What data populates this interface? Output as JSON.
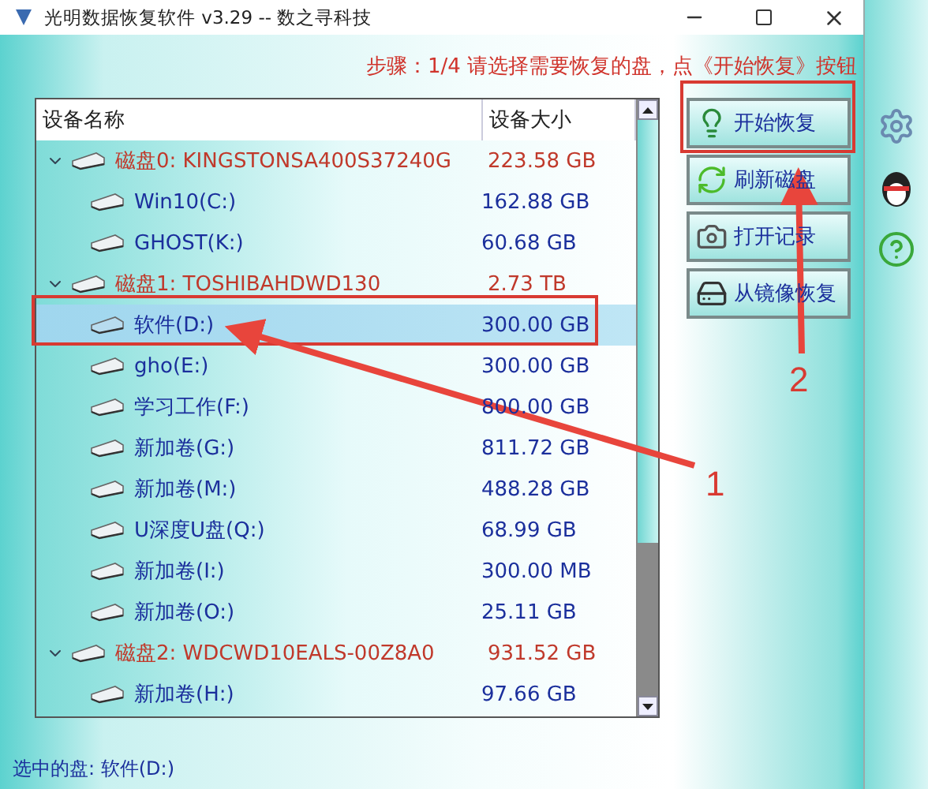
{
  "window": {
    "title": "光明数据恢复软件 v3.29 -- 数之寻科技"
  },
  "step_hint": "步骤：1/4 请选择需要恢复的盘，点《开始恢复》按钮",
  "device_list": {
    "columns": [
      "设备名称",
      "设备大小"
    ],
    "disks": [
      {
        "name": "磁盘0: KINGSTONSA400S37240G",
        "size": "223.58 GB",
        "expanded": true,
        "selected": false,
        "children": [
          {
            "name": "Win10(C:)",
            "size": "162.88 GB",
            "selected": false
          },
          {
            "name": "GHOST(K:)",
            "size": "60.68 GB",
            "selected": false
          }
        ]
      },
      {
        "name": "磁盘1: TOSHIBAHDWD130",
        "size": "2.73 TB",
        "expanded": true,
        "selected": false,
        "children": [
          {
            "name": "软件(D:)",
            "size": "300.00 GB",
            "selected": true
          },
          {
            "name": "gho(E:)",
            "size": "300.00 GB",
            "selected": false
          },
          {
            "name": "学习工作(F:)",
            "size": "800.00 GB",
            "selected": false
          },
          {
            "name": "新加卷(G:)",
            "size": "811.72 GB",
            "selected": false
          },
          {
            "name": "新加卷(M:)",
            "size": "488.28 GB",
            "selected": false
          },
          {
            "name": "U深度U盘(Q:)",
            "size": "68.99 GB",
            "selected": false
          },
          {
            "name": "新加卷(I:)",
            "size": "300.00 MB",
            "selected": false
          },
          {
            "name": "新加卷(O:)",
            "size": "25.11 GB",
            "selected": false
          }
        ]
      },
      {
        "name": "磁盘2: WDCWD10EALS-00Z8A0",
        "size": "931.52 GB",
        "expanded": true,
        "selected": false,
        "children": [
          {
            "name": "新加卷(H:)",
            "size": "97.66 GB",
            "selected": false
          }
        ]
      }
    ]
  },
  "buttons": [
    {
      "label": "开始恢复",
      "kind": "start"
    },
    {
      "label": "刷新磁盘",
      "kind": "refresh"
    },
    {
      "label": "打开记录",
      "kind": "log"
    },
    {
      "label": "从镜像恢复",
      "kind": "image"
    }
  ],
  "status_bar": "选中的盘: 软件(D:)",
  "annotations": [
    {
      "number": "1"
    },
    {
      "number": "2"
    }
  ]
}
